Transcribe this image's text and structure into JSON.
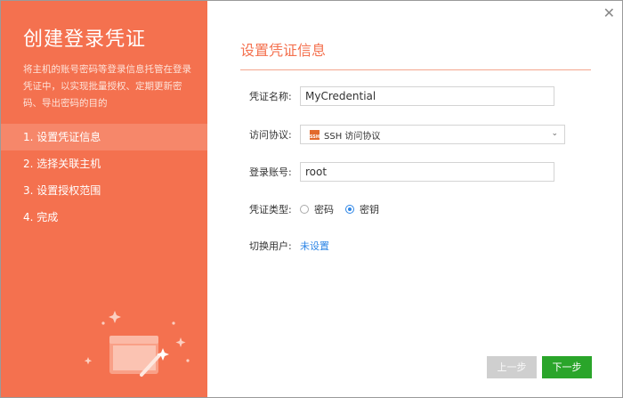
{
  "sidebar": {
    "title": "创建登录凭证",
    "description": "将主机的账号密码等登录信息托管在登录凭证中，以实现批量授权、定期更新密码、导出密码的目的",
    "steps": [
      {
        "label": "1. 设置凭证信息",
        "active": true
      },
      {
        "label": "2. 选择关联主机",
        "active": false
      },
      {
        "label": "3. 设置授权范围",
        "active": false
      },
      {
        "label": "4. 完成",
        "active": false
      }
    ],
    "illustration_icon": "magic-wand-window-icon"
  },
  "main": {
    "close_icon": "close-icon",
    "section_title": "设置凭证信息",
    "fields": {
      "name": {
        "label": "凭证名称:",
        "value": "MyCredential"
      },
      "protocol": {
        "label": "访问协议:",
        "value": "SSH 访问协议",
        "badge": "SSH",
        "icon": "ssh-icon"
      },
      "account": {
        "label": "登录账号:",
        "value": "root"
      },
      "type": {
        "label": "凭证类型:",
        "options": [
          {
            "label": "密码",
            "checked": false
          },
          {
            "label": "密钥",
            "checked": true
          }
        ]
      },
      "switch_user": {
        "label": "切换用户:",
        "value": "未设置"
      }
    },
    "buttons": {
      "prev": "上一步",
      "next": "下一步"
    }
  },
  "colors": {
    "accent": "#f4714f",
    "link": "#2e86e6",
    "primary_button": "#2aa52a",
    "disabled_button": "#cfcfcf"
  }
}
